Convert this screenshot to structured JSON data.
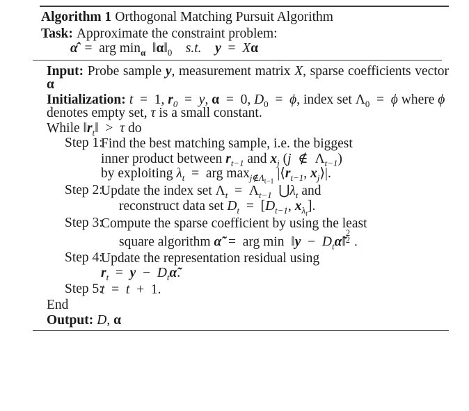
{
  "document": {
    "kind": "algorithm-pseudocode-float",
    "algorithm_number": "Algorithm 1",
    "algorithm_title": "Orthogonal Matching Pursuit Algorithm",
    "task": {
      "label": "Task:",
      "text": "Approximate the constraint problem:",
      "equation_plain": "α̂ = arg min_α ‖α‖₀  s.t.  y = Xα"
    },
    "input": {
      "label": "Input:",
      "text_plain": "Probe sample y, measurement matrix X, sparse coefficients vector α"
    },
    "initialization": {
      "label": "Initialization:",
      "line1_plain": "t = 1, r₀ = y, α = 0, D₀ = φ, index set",
      "line2_plain": "Λ₀ = φ where φ denotes empty set, τ is a small constant."
    },
    "while": {
      "text_plain": "While ‖r_t‖ > τ do"
    },
    "steps": [
      {
        "label": "Step 1:",
        "line1_plain": "Find the best matching sample, i.e. the biggest",
        "line2_plain": "inner product between r_{t−1} and x_j (j ∉ Λ_{t−1})",
        "line3_plain": "by exploiting λ_t = arg max_{j∉Λ_{t−1}} |⟨r_{t−1}, x_j⟩|."
      },
      {
        "label": "Step 2:",
        "line1_plain": "Update the index set Λ_t = Λ_{t−1} ⋃ λ_t and",
        "line2_plain": "reconstruct data set D_t = [D_{t−1}, x_{λ_t}]."
      },
      {
        "label": "Step 3:",
        "line1_plain": "Compute the sparse coefficient by using the least",
        "line2_plain": "square algorithm α̃ = arg min ‖y − D_t α̃‖²₂."
      },
      {
        "label": "Step 4:",
        "line1_plain": "Update the representation residual using",
        "line2_plain": "r_t = y − D_t α̃."
      },
      {
        "label": "Step 5:",
        "line1_plain": "t = t + 1."
      }
    ],
    "end": {
      "text": "End"
    },
    "output": {
      "label": "Output:",
      "text_plain": "D, α"
    },
    "tokens": {
      "alpha": "α",
      "alpha_hat": "α̂",
      "alpha_tilde": "α̃",
      "phi": "φ",
      "tau": "τ",
      "lambda": "λ",
      "Lambda": "Λ",
      "union": "⋃",
      "notin": "∉",
      "gt": ">",
      "eq": "=",
      "minus": "−",
      "plus": "+",
      "arg": "arg",
      "min": "min",
      "max": "max",
      "st": "s.t.",
      "norm_bar": "‖",
      "angle_open": "⟨",
      "angle_close": "⟩",
      "abs_bar": "|",
      "zero": "0",
      "one": "1",
      "two": "2",
      "y": "y",
      "X": "X",
      "D": "D",
      "r": "r",
      "x": "x",
      "t": "t",
      "j": "j",
      "comma": ",",
      "period": ".",
      "colon": ":",
      "bracket_open": "[",
      "bracket_close": "]",
      "paren_open": "(",
      "paren_close": ")",
      "do": "do",
      "where_clause": "where",
      "denotes_clause": "denotes empty set,",
      "is_small_const": "is a small constant.",
      "index_set": "index set"
    },
    "colors": {
      "page_background": "#ffffff",
      "text": "#1a1a1a",
      "rule": "#3b3b3b"
    }
  }
}
